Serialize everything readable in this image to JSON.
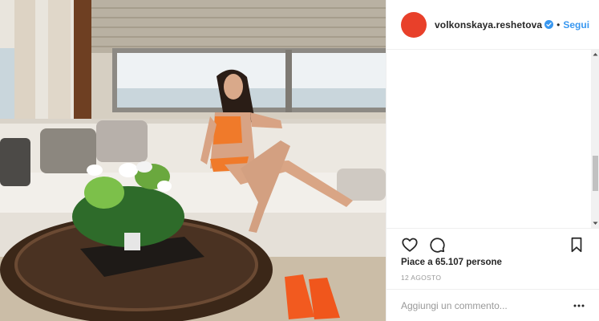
{
  "post": {
    "image_alt": "Woman in orange bikini sitting on a sofa in a yacht lounge",
    "colors": {
      "avatar": "#e8402a",
      "follow": "#3897f0",
      "verified": "#3897f0"
    }
  },
  "header": {
    "username": "volkonskaya.reshetova",
    "separator": "•",
    "follow_label": "Segui",
    "verified_icon": "verified-badge-icon"
  },
  "actions": {
    "like_icon": "heart-icon",
    "comment_icon": "comment-icon",
    "save_icon": "bookmark-icon"
  },
  "stats": {
    "likes_text": "Piace a 65.107 persone",
    "date_text": "12 AGOSTO"
  },
  "comment": {
    "placeholder": "Aggiungi un commento...",
    "more_icon": "more-options-icon"
  }
}
